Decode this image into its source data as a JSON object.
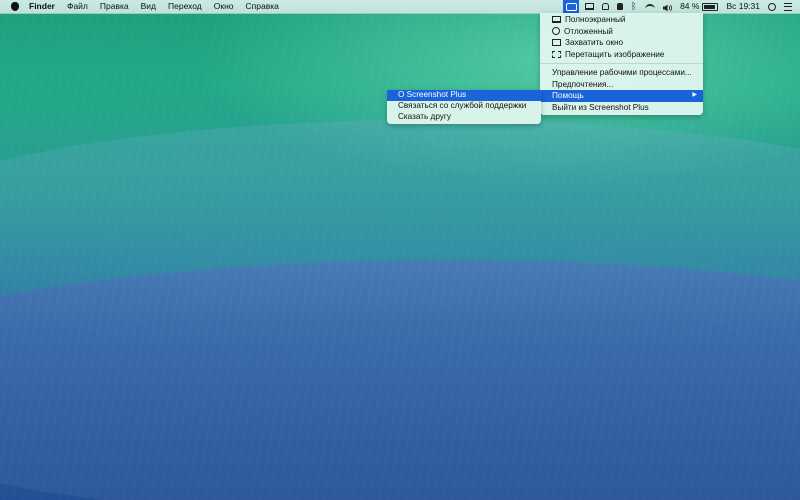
{
  "menubar": {
    "app_name": "Finder",
    "items": [
      "Файл",
      "Правка",
      "Вид",
      "Переход",
      "Окно",
      "Справка"
    ],
    "battery_percent": "84 %",
    "battery_level": 0.84,
    "clock": "Вс 19:31",
    "status_icons": [
      "screenshot-plus-icon",
      "display-icon",
      "cat-icon",
      "lock-icon",
      "bluetooth-icon",
      "wifi-icon",
      "volume-icon",
      "battery-icon",
      "search-icon",
      "list-icon"
    ]
  },
  "app_menu": {
    "items": [
      {
        "label": "Полноэкранный",
        "icon": "monitor-icon"
      },
      {
        "label": "Отложенный",
        "icon": "clock-icon"
      },
      {
        "label": "Захватить окно",
        "icon": "window-icon"
      },
      {
        "label": "Перетащить изображение",
        "icon": "selection-icon"
      }
    ],
    "items2": [
      "Управление рабочими процессами...",
      "Предпочтения...",
      "Помощь",
      "Выйти из Screenshot Plus"
    ],
    "highlighted": "Помощь"
  },
  "help_submenu": {
    "items": [
      "О Screenshot Plus",
      "Связаться со службой поддержки",
      "Сказать другу"
    ],
    "highlighted": "О Screenshot Plus"
  },
  "colors": {
    "accent": "#1a63d8",
    "menu_bg": "#e4f7f0"
  }
}
